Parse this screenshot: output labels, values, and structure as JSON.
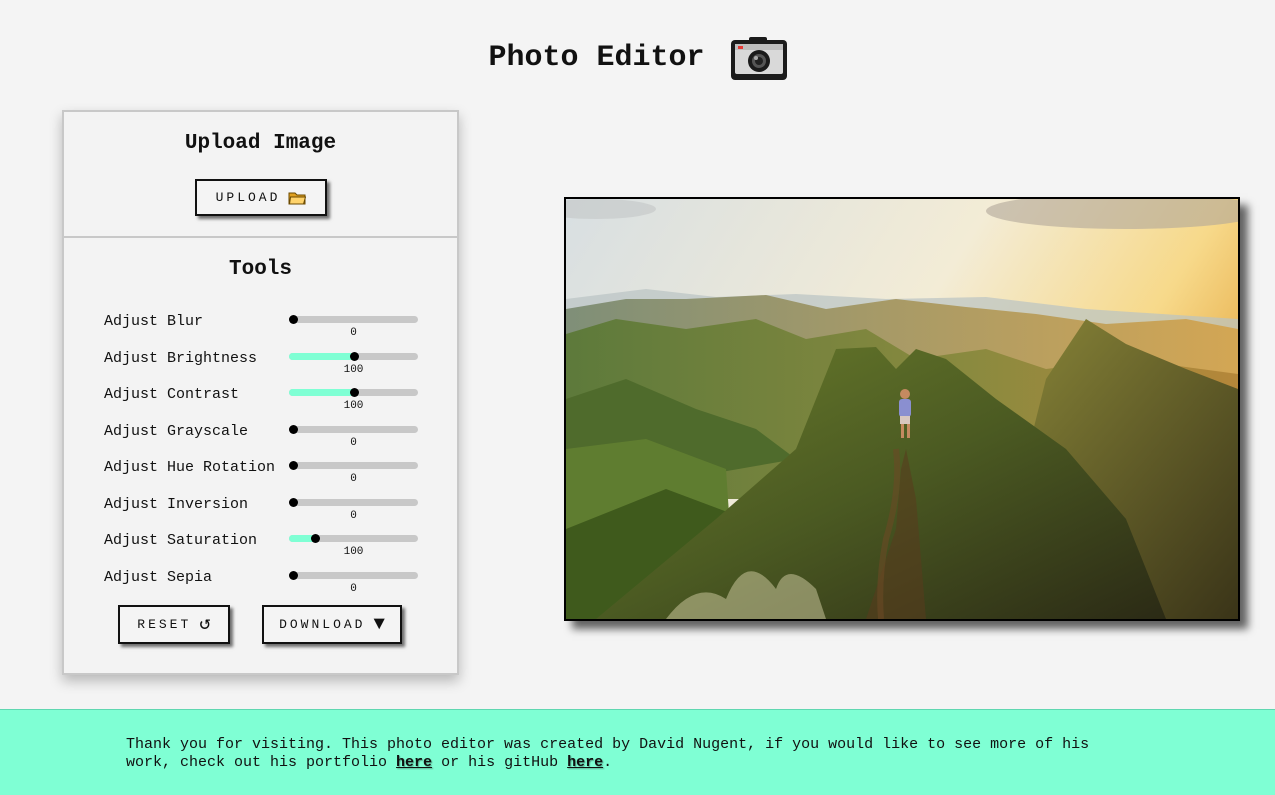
{
  "header": {
    "title": "Photo Editor",
    "icon": "camera-icon"
  },
  "upload": {
    "title": "Upload Image",
    "button_label": "UPLOAD",
    "button_icon": "folder-icon"
  },
  "tools": {
    "title": "Tools",
    "sliders": [
      {
        "label": "Adjust Blur",
        "value": "0",
        "fraction": 0.0
      },
      {
        "label": "Adjust Brightness",
        "value": "100",
        "fraction": 0.5
      },
      {
        "label": "Adjust Contrast",
        "value": "100",
        "fraction": 0.5
      },
      {
        "label": "Adjust Grayscale",
        "value": "0",
        "fraction": 0.0
      },
      {
        "label": "Adjust Hue Rotation",
        "value": "0",
        "fraction": 0.0
      },
      {
        "label": "Adjust Inversion",
        "value": "0",
        "fraction": 0.0
      },
      {
        "label": "Adjust Saturation",
        "value": "100",
        "fraction": 0.2
      },
      {
        "label": "Adjust Sepia",
        "value": "0",
        "fraction": 0.0
      }
    ],
    "reset_label": "RESET",
    "reset_icon": "↺",
    "download_label": "DOWNLOAD",
    "download_icon": "▼"
  },
  "colors": {
    "accent": "#7fffd4",
    "track": "#c8c8c8",
    "background": "#f4f4f4"
  },
  "footer": {
    "text_before": "Thank you for visiting. This photo editor was created by David Nugent, if you would like to see more of his work, check out his portfolio ",
    "portfolio_link": "here",
    "text_middle": " or his gitHub ",
    "github_link": "here",
    "text_after": "."
  }
}
